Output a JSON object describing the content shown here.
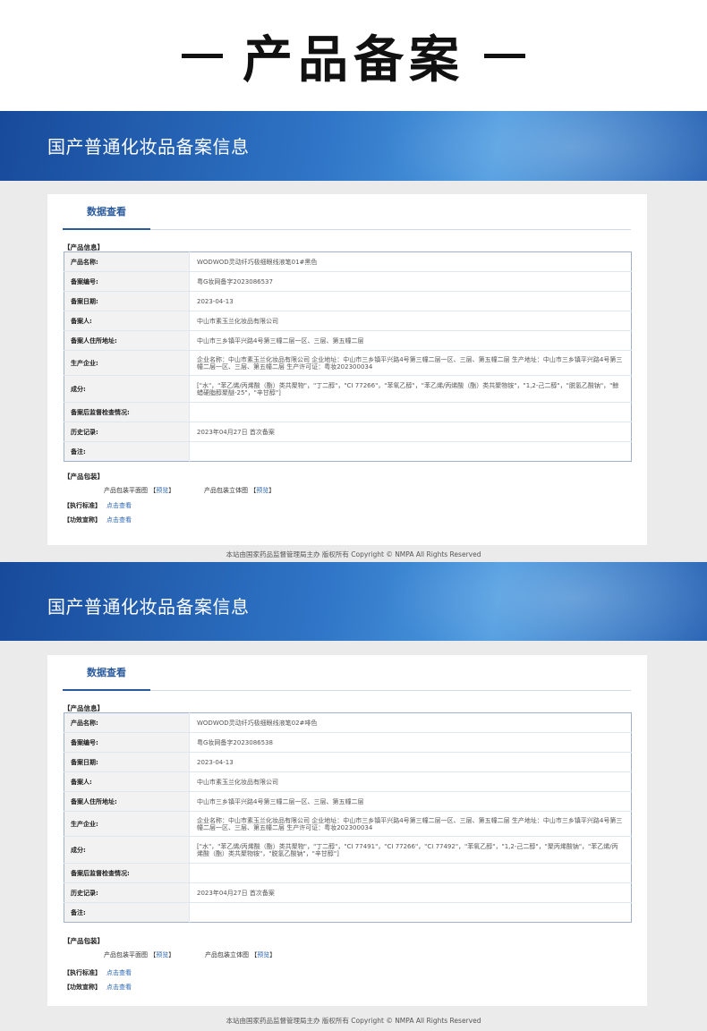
{
  "page_title": "产品备案",
  "records": [
    {
      "banner_title": "国产普通化妆品备案信息",
      "tab_label": "数据查看",
      "product_info_label": "【产品信息】",
      "rows": [
        {
          "key": "产品名称:",
          "value": "WODWOD灵动纤巧极细眼线液笔01#黑色"
        },
        {
          "key": "备案编号:",
          "value": "粤G妆网备字2023086537"
        },
        {
          "key": "备案日期:",
          "value": "2023-04-13"
        },
        {
          "key": "备案人:",
          "value": "中山市素玉兰化妆品有限公司"
        },
        {
          "key": "备案人住所地址:",
          "value": "中山市三乡镇平兴路4号第三幢二层一区、三层、第五幢二层"
        },
        {
          "key": "生产企业:",
          "value": "企业名称：中山市素玉兰化妆品有限公司 企业地址：中山市三乡镇平兴路4号第三幢二层一区、三层、第五幢二层 生产地址：中山市三乡镇平兴路4号第三幢二层一区、三层、第五幢二层 生产许可证：粤妆202300034"
        },
        {
          "key": "成分:",
          "value": "[\"水\"，\"苯乙烯/丙烯酸（酯）类共聚物\"，\"丁二醇\"，\"CI 77266\"，\"苯氧乙醇\"，\"苯乙烯/丙烯酸（酯）类共聚物铵\"，\"1,2-己二醇\"，\"脱氢乙酸钠\"，\"鲸蜡硬脂醇聚醚-25\"，\"辛甘醇\"]"
        },
        {
          "key": "备案后监督检查情况:",
          "value": ""
        },
        {
          "key": "历史记录:",
          "value": "2023年04月27日 首次备案"
        },
        {
          "key": "备注:",
          "value": ""
        }
      ],
      "packaging_label": "【产品包装】",
      "pkg_front_label": "产品包装平面图",
      "pkg_3d_label": "产品包装立体图",
      "preview_link": "预览",
      "standard_label": "【执行标准】",
      "efficacy_label": "【功效宣称】",
      "view_link": "点击查看",
      "footer": "本站由国家药品监督管理局主办 版权所有 Copyright © NMPA All Rights Reserved"
    },
    {
      "banner_title": "国产普通化妆品备案信息",
      "tab_label": "数据查看",
      "product_info_label": "【产品信息】",
      "rows": [
        {
          "key": "产品名称:",
          "value": "WODWOD灵动纤巧极细眼线液笔02#啡色"
        },
        {
          "key": "备案编号:",
          "value": "粤G妆网备字2023086538"
        },
        {
          "key": "备案日期:",
          "value": "2023-04-13"
        },
        {
          "key": "备案人:",
          "value": "中山市素玉兰化妆品有限公司"
        },
        {
          "key": "备案人住所地址:",
          "value": "中山市三乡镇平兴路4号第三幢二层一区、三层、第五幢二层"
        },
        {
          "key": "生产企业:",
          "value": "企业名称：中山市素玉兰化妆品有限公司 企业地址：中山市三乡镇平兴路4号第三幢二层一区、三层、第五幢二层 生产地址：中山市三乡镇平兴路4号第三幢二层一区、三层、第五幢二层 生产许可证：粤妆202300034"
        },
        {
          "key": "成分:",
          "value": "[\"水\"，\"苯乙烯/丙烯酸（酯）类共聚物\"，\"丁二醇\"，\"CI 77491\"，\"CI 77266\"，\"CI 77492\"，\"苯氧乙醇\"，\"1,2-己二醇\"，\"聚丙烯酸钠\"，\"苯乙烯/丙烯酸（酯）类共聚物铵\"，\"脱氢乙酸钠\"，\"辛甘醇\"]"
        },
        {
          "key": "备案后监督检查情况:",
          "value": ""
        },
        {
          "key": "历史记录:",
          "value": "2023年04月27日 首次备案"
        },
        {
          "key": "备注:",
          "value": ""
        }
      ],
      "packaging_label": "【产品包装】",
      "pkg_front_label": "产品包装平面图",
      "pkg_3d_label": "产品包装立体图",
      "preview_link": "预览",
      "standard_label": "【执行标准】",
      "efficacy_label": "【功效宣称】",
      "view_link": "点击查看",
      "footer": "本站由国家药品监督管理局主办 版权所有 Copyright © NMPA All Rights Reserved"
    }
  ]
}
